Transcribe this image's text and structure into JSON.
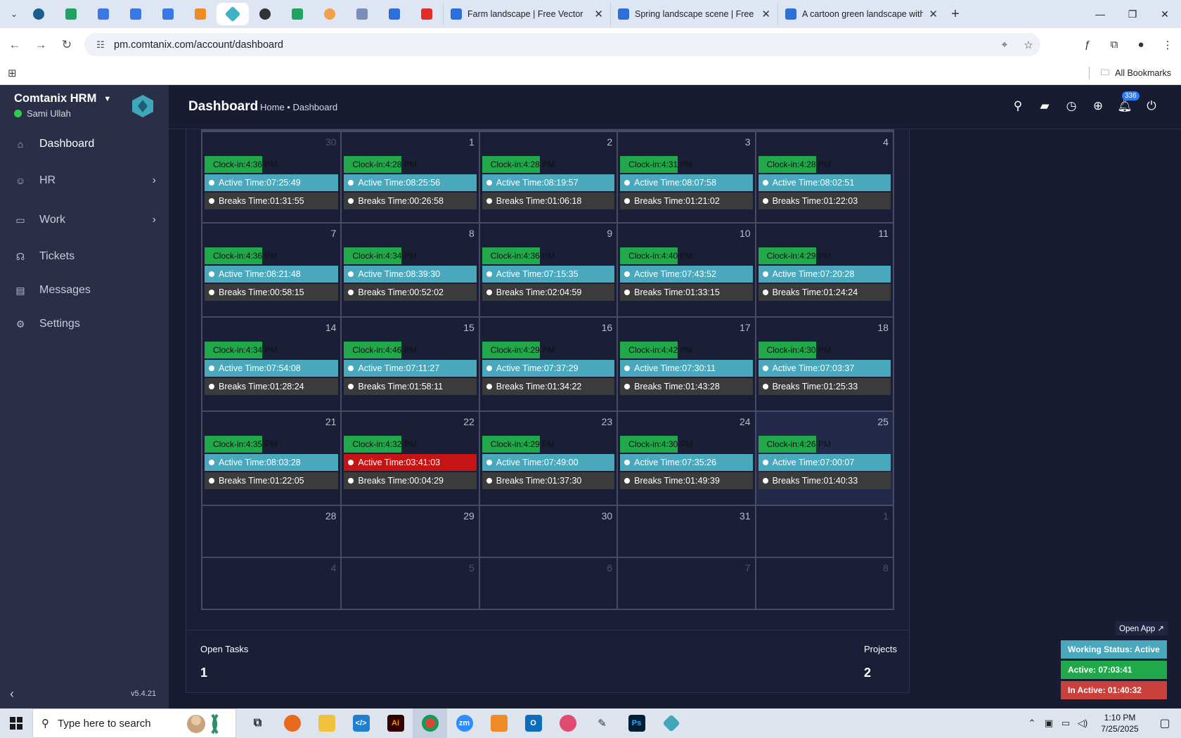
{
  "browser": {
    "tabs": [
      {
        "title": "Farm landscape | Free Vector"
      },
      {
        "title": "Spring landscape scene | Free V"
      },
      {
        "title": "A cartoon green landscape with"
      }
    ],
    "url": "pm.comtanix.com/account/dashboard",
    "bookmarks_label": "All Bookmarks"
  },
  "sidebar": {
    "brand": "Comtanix HRM",
    "user": "Sami Ullah",
    "items": [
      {
        "label": "Dashboard"
      },
      {
        "label": "HR"
      },
      {
        "label": "Work"
      },
      {
        "label": "Tickets"
      },
      {
        "label": "Messages"
      },
      {
        "label": "Settings"
      }
    ],
    "version": "v5.4.21"
  },
  "header": {
    "title": "Dashboard",
    "breadcrumb": "Home • Dashboard",
    "notifications": "336"
  },
  "calendar": {
    "labels": {
      "clock": "Clock-in: ",
      "active": "Active Time: ",
      "break": "Breaks Time: "
    },
    "weeks": [
      [
        {
          "day": "30",
          "other": true,
          "clock": "4:36 PM",
          "active": "07:25:49",
          "break": "01:31:55"
        },
        {
          "day": "1",
          "clock": "4:28 PM",
          "active": "08:25:56",
          "break": "00:26:58"
        },
        {
          "day": "2",
          "clock": "4:28 PM",
          "active": "08:19:57",
          "break": "01:06:18"
        },
        {
          "day": "3",
          "clock": "4:31 PM",
          "active": "08:07:58",
          "break": "01:21:02"
        },
        {
          "day": "4",
          "clock": "4:28 PM",
          "active": "08:02:51",
          "break": "01:22:03"
        }
      ],
      [
        {
          "day": "7",
          "clock": "4:36 PM",
          "active": "08:21:48",
          "break": "00:58:15"
        },
        {
          "day": "8",
          "clock": "4:34 PM",
          "active": "08:39:30",
          "break": "00:52:02"
        },
        {
          "day": "9",
          "clock": "4:36 PM",
          "active": "07:15:35",
          "break": "02:04:59"
        },
        {
          "day": "10",
          "clock": "4:40 PM",
          "active": "07:43:52",
          "break": "01:33:15"
        },
        {
          "day": "11",
          "clock": "4:29 PM",
          "active": "07:20:28",
          "break": "01:24:24"
        }
      ],
      [
        {
          "day": "14",
          "clock": "4:34 PM",
          "active": "07:54:08",
          "break": "01:28:24"
        },
        {
          "day": "15",
          "clock": "4:46 PM",
          "active": "07:11:27",
          "break": "01:58:11"
        },
        {
          "day": "16",
          "clock": "4:29 PM",
          "active": "07:37:29",
          "break": "01:34:22"
        },
        {
          "day": "17",
          "clock": "4:42 PM",
          "active": "07:30:11",
          "break": "01:43:28"
        },
        {
          "day": "18",
          "clock": "4:30 PM",
          "active": "07:03:37",
          "break": "01:25:33"
        }
      ],
      [
        {
          "day": "21",
          "clock": "4:35 PM",
          "active": "08:03:28",
          "break": "01:22:05"
        },
        {
          "day": "22",
          "clock": "4:32 PM",
          "active": "03:41:03",
          "break": "00:04:29",
          "low": true
        },
        {
          "day": "23",
          "clock": "4:29 PM",
          "active": "07:49:00",
          "break": "01:37:30"
        },
        {
          "day": "24",
          "clock": "4:30 PM",
          "active": "07:35:26",
          "break": "01:49:39"
        },
        {
          "day": "25",
          "clock": "4:26 PM",
          "active": "07:00:07",
          "break": "01:40:33",
          "today": true
        }
      ],
      [
        {
          "day": "28"
        },
        {
          "day": "29"
        },
        {
          "day": "30"
        },
        {
          "day": "31"
        },
        {
          "day": "1",
          "other": true
        }
      ],
      [
        {
          "day": "4",
          "other": true
        },
        {
          "day": "5",
          "other": true
        },
        {
          "day": "6",
          "other": true
        },
        {
          "day": "7",
          "other": true
        },
        {
          "day": "8",
          "other": true
        }
      ]
    ]
  },
  "stats": {
    "open_tasks_label": "Open Tasks",
    "open_tasks_value": "1",
    "projects_label": "Projects",
    "projects_value": "2"
  },
  "widget": {
    "open_app": "Open App ↗",
    "working_status": "Working Status: Active",
    "active": "Active: 07:03:41",
    "inactive": "In Active: 01:40:32"
  },
  "taskbar": {
    "search_placeholder": "Type here to search",
    "time": "1:10 PM",
    "date": "7/25/2025"
  }
}
